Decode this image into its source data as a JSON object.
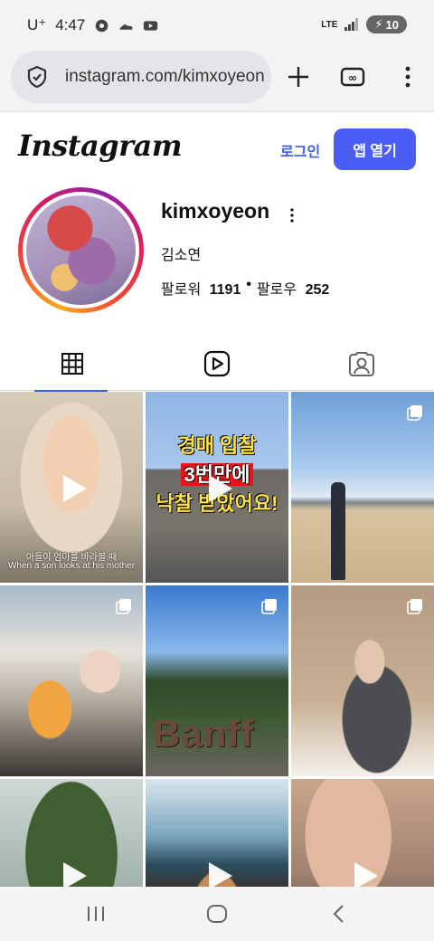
{
  "status_bar": {
    "carrier": "U⁺",
    "time": "4:47",
    "network": "LTE",
    "battery": "10"
  },
  "browser": {
    "url": "instagram.com/kimxoyeon",
    "icons": [
      "site-info-icon",
      "new-tab-icon",
      "tab-switcher-icon",
      "menu-icon"
    ]
  },
  "header": {
    "logo_text": "Instagram",
    "login_label": "로그인",
    "open_app_label": "앱 열기"
  },
  "profile": {
    "username": "kimxoyeon",
    "full_name": "김소연",
    "followers_label": "팔로워",
    "followers_count": "1191",
    "following_label": "팔로우",
    "following_count": "252"
  },
  "tabs": [
    {
      "name": "posts",
      "icon": "grid-icon",
      "active": true
    },
    {
      "name": "reels",
      "icon": "reels-icon",
      "active": false
    },
    {
      "name": "tagged",
      "icon": "tagged-icon",
      "active": false
    }
  ],
  "posts": [
    {
      "type": "reel",
      "caption_top": "아들이 엄마를 바라볼 때",
      "caption_bottom": "When a son looks at his mother"
    },
    {
      "type": "reel",
      "text_line1": "경매 입찰",
      "text_line2": "3번만에",
      "text_line3": "낙찰 받았어요!"
    },
    {
      "type": "carousel"
    },
    {
      "type": "carousel"
    },
    {
      "type": "carousel",
      "sign": "Banff"
    },
    {
      "type": "carousel"
    },
    {
      "type": "reel"
    },
    {
      "type": "reel"
    },
    {
      "type": "reel"
    }
  ],
  "colors": {
    "accent": "#3a5df0",
    "button": "#4a5df9"
  }
}
